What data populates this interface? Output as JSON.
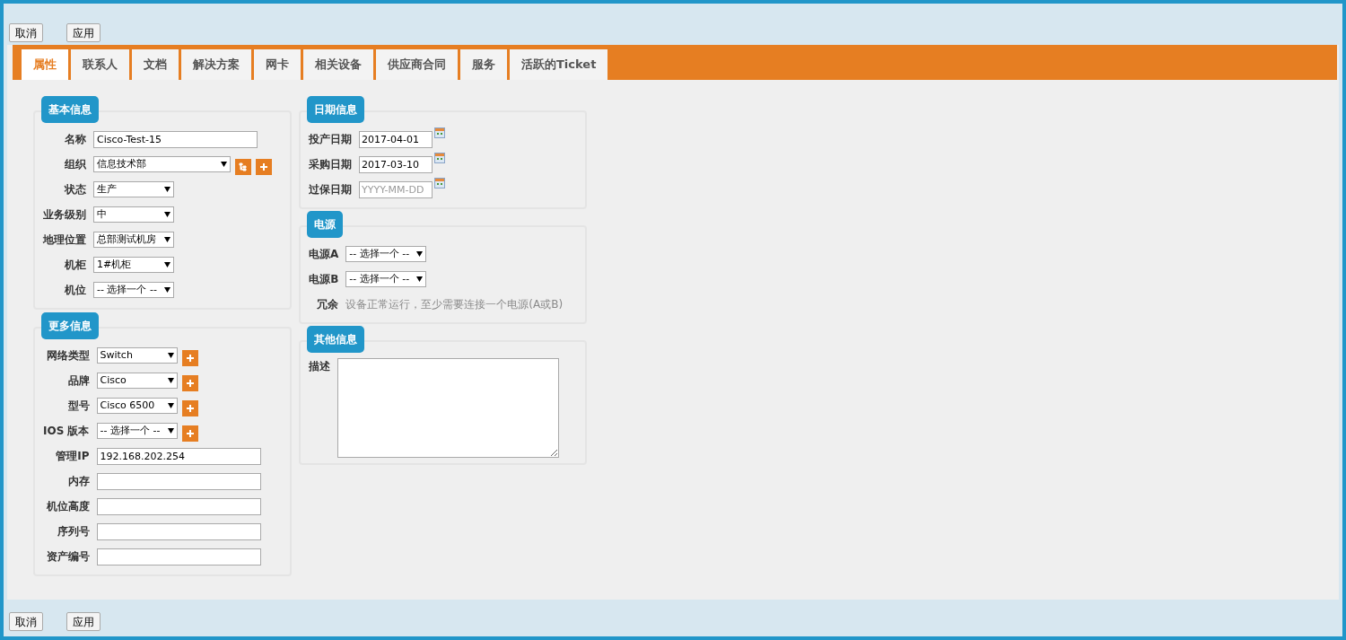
{
  "top_buttons": [
    "取消",
    "应用"
  ],
  "tabs": [
    {
      "label": "属性",
      "selected": true
    },
    {
      "label": "联系人",
      "selected": false
    },
    {
      "label": "文档",
      "selected": false
    },
    {
      "label": "解决方案",
      "selected": false
    },
    {
      "label": "网卡",
      "selected": false
    },
    {
      "label": "相关设备",
      "selected": false
    },
    {
      "label": "供应商合同",
      "selected": false
    },
    {
      "label": "服务",
      "selected": false
    },
    {
      "label": "活跃的Ticket",
      "selected": false
    }
  ],
  "left_sections": [
    {
      "title": "基本信息",
      "fields": [
        {
          "kind": "text",
          "label": "名称",
          "value": "Cisco-Test-15"
        },
        {
          "kind": "wide_select",
          "label": "组织",
          "value": "信息技术部",
          "buttons": [
            {
              "kind": "tree"
            },
            {
              "kind": "add"
            }
          ]
        },
        {
          "kind": "select",
          "label": "状态",
          "value": "生产"
        },
        {
          "kind": "select",
          "label": "业务级别",
          "value": "中"
        },
        {
          "kind": "select",
          "label": "地理位置",
          "value": "总部测试机房"
        },
        {
          "kind": "select",
          "label": "机柜",
          "value": "1#机柜"
        },
        {
          "kind": "select",
          "label": "机位",
          "value": "-- 选择一个 --"
        }
      ]
    },
    {
      "title": "更多信息",
      "fields": [
        {
          "kind": "select",
          "label": "网络类型",
          "value": "Switch",
          "buttons": [
            {
              "kind": "add"
            }
          ]
        },
        {
          "kind": "select",
          "label": "品牌",
          "value": "Cisco",
          "buttons": [
            {
              "kind": "add"
            }
          ]
        },
        {
          "kind": "select",
          "label": "型号",
          "value": "Cisco 6500",
          "buttons": [
            {
              "kind": "add"
            }
          ]
        },
        {
          "kind": "select",
          "label": "IOS 版本",
          "value": "-- 选择一个 --",
          "buttons": [
            {
              "kind": "add"
            }
          ]
        },
        {
          "kind": "text",
          "label": "管理IP",
          "value": "192.168.202.254"
        },
        {
          "kind": "text",
          "label": "内存"
        },
        {
          "kind": "text",
          "label": "机位高度"
        },
        {
          "kind": "text",
          "label": "序列号"
        },
        {
          "kind": "text",
          "label": "资产编号"
        }
      ]
    }
  ],
  "right_sections": [
    {
      "title": "日期信息",
      "fields": [
        {
          "kind": "date",
          "label": "投产日期",
          "value": "2017-04-01"
        },
        {
          "kind": "date",
          "label": "采购日期",
          "value": "2017-03-10"
        },
        {
          "kind": "date",
          "label": "过保日期",
          "placeholder": "YYYY-MM-DD"
        }
      ]
    },
    {
      "title": "电源",
      "fields": [
        {
          "kind": "select",
          "label": "电源A",
          "value": "-- 选择一个 --"
        },
        {
          "kind": "select",
          "label": "电源B",
          "value": "-- 选择一个 --"
        },
        {
          "kind": "note",
          "label": "冗余",
          "text": "设备正常运行，至少需要连接一个电源(A或B)"
        }
      ]
    },
    {
      "title": "其他信息",
      "fields": [
        {
          "kind": "textarea",
          "label": "描述"
        }
      ]
    }
  ],
  "bottom_buttons": [
    "取消",
    "应用"
  ]
}
